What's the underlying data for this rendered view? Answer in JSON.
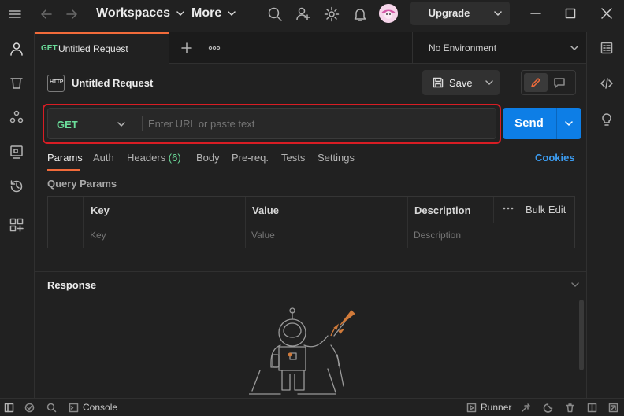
{
  "topbar": {
    "workspaces_label": "Workspaces",
    "more_label": "More",
    "upgrade_label": "Upgrade"
  },
  "tab": {
    "method": "GET",
    "title": "Untitled Request"
  },
  "environment": {
    "label": "No Environment"
  },
  "request": {
    "badge": "HTTP",
    "title": "Untitled Request",
    "save_label": "Save",
    "method": "GET",
    "url_placeholder": "Enter URL or paste text",
    "send_label": "Send"
  },
  "request_tabs": {
    "params": "Params",
    "auth": "Auth",
    "headers": "Headers",
    "headers_count": "(6)",
    "body": "Body",
    "prereq": "Pre-req.",
    "tests": "Tests",
    "settings": "Settings",
    "cookies": "Cookies"
  },
  "query_params": {
    "title": "Query Params",
    "columns": {
      "key": "Key",
      "value": "Value",
      "description": "Description",
      "bulk_edit": "Bulk Edit"
    },
    "row_placeholders": {
      "key": "Key",
      "value": "Value",
      "description": "Description"
    }
  },
  "response": {
    "title": "Response"
  },
  "statusbar": {
    "console_label": "Console",
    "runner_label": "Runner"
  },
  "colors": {
    "accent": "#f26b3a",
    "send_button": "#0d7ee6",
    "get_method": "#6bdd9a",
    "cookies_link": "#3c9cf0",
    "highlight_box": "#d81d24"
  },
  "icons": {
    "rail": [
      "user-icon",
      "trash-icon",
      "apis-icon",
      "mock-server-icon",
      "history-icon",
      "add-apps-icon"
    ],
    "right_rail": [
      "code-icon",
      "lightbulb-icon"
    ]
  }
}
